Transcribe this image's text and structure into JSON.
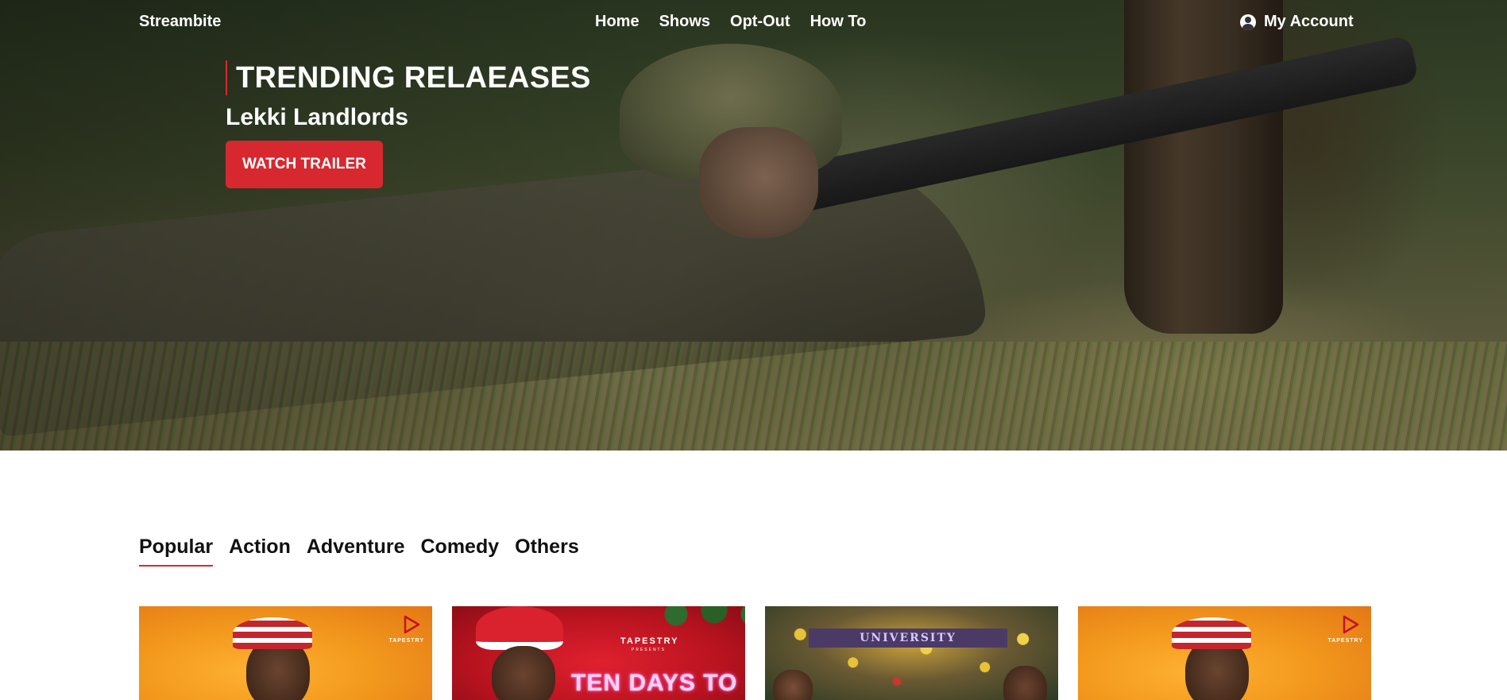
{
  "nav": {
    "brand": "Streambite",
    "links": [
      "Home",
      "Shows",
      "Opt-Out",
      "How To"
    ],
    "account_label": "My Account"
  },
  "hero": {
    "heading": "TRENDING RELAEASES",
    "movie_title": "Lekki Landlords",
    "cta_label": "WATCH TRAILER",
    "accent_color": "#d8282f"
  },
  "tabs": {
    "items": [
      "Popular",
      "Action",
      "Adventure",
      "Comedy",
      "Others"
    ],
    "active": "Popular"
  },
  "cards": [
    {
      "poster_brand": "TAPESTRY"
    },
    {
      "poster_brand": "TAPESTRY",
      "poster_presents": "PRESENTS",
      "poster_title": "TEN DAYS TO"
    },
    {
      "poster_sign": "UNIVERSITY"
    },
    {
      "poster_brand": "TAPESTRY"
    }
  ]
}
